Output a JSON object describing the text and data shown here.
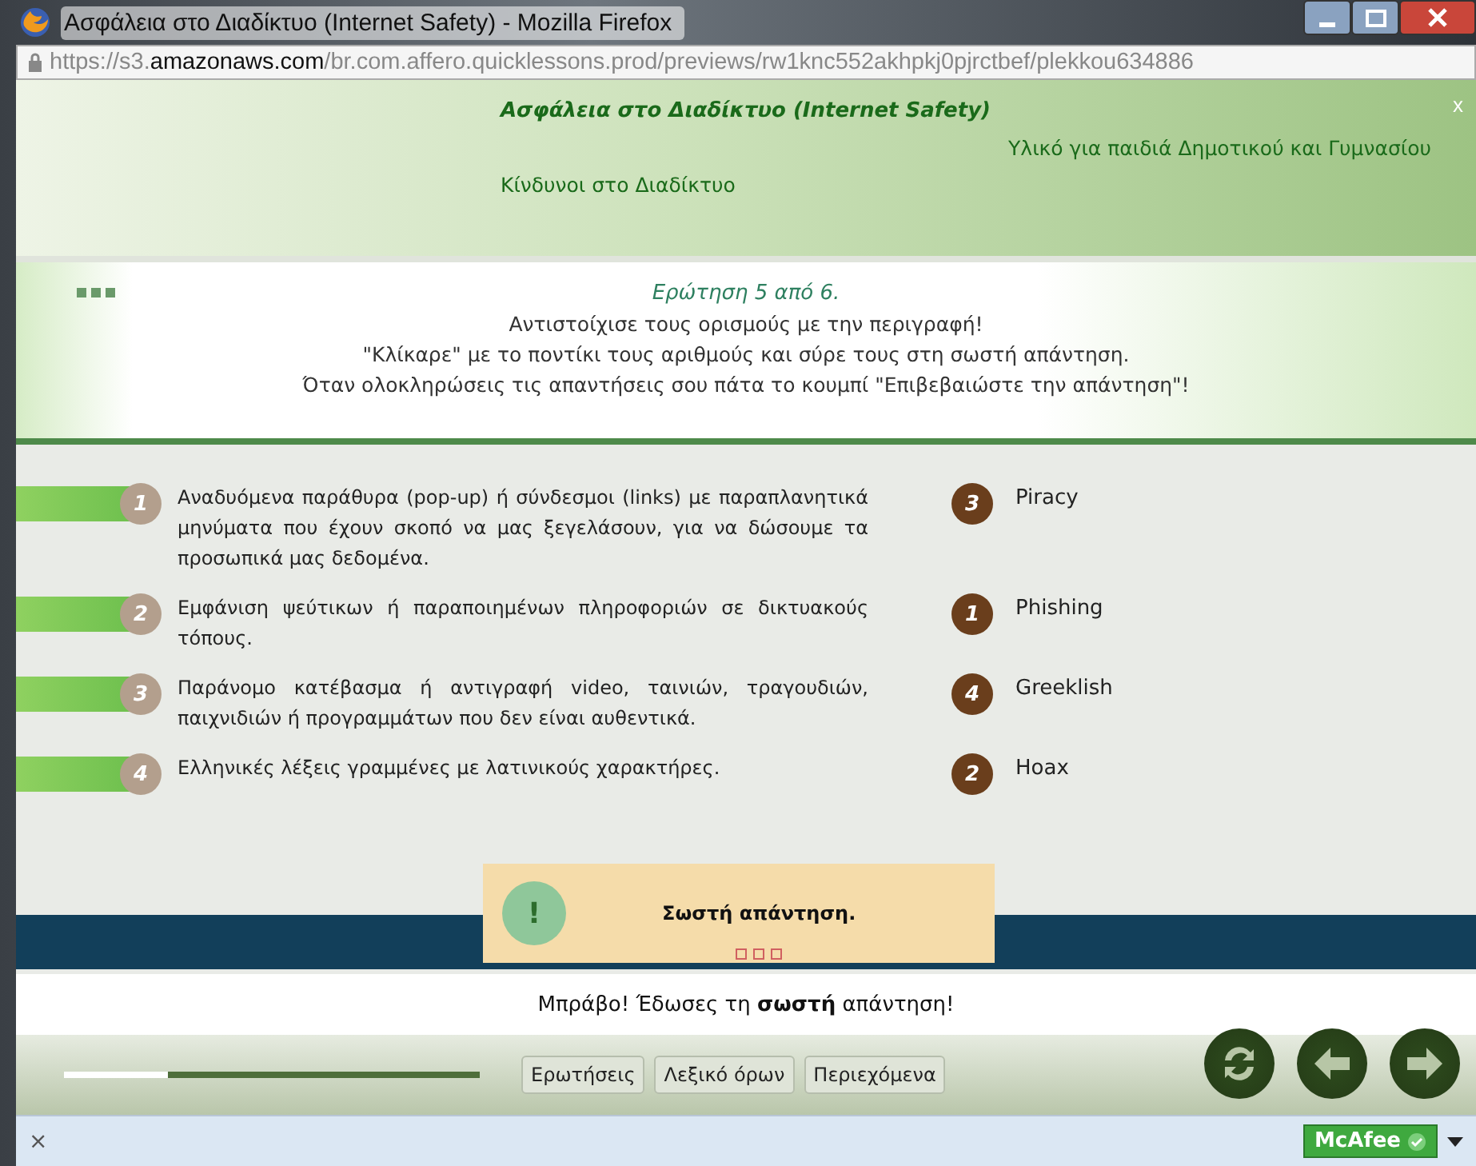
{
  "window": {
    "title": "Ασφάλεια στο Διαδίκτυο (Internet Safety) - Mozilla Firefox"
  },
  "address_bar": {
    "scheme": "https://s3.",
    "domain": "amazonaws.com",
    "path": "/br.com.affero.quicklessons.prod/previews/rw1knc552akhpkj0pjrctbef/plekkou634886"
  },
  "header": {
    "title": "Ασφάλεια στο Διαδίκτυο (Internet Safety)",
    "subtitle": "Υλικό για παιδιά Δημοτικού και Γυμνασίου",
    "section": "Κίνδυνοι στο Διαδίκτυο",
    "close": "x"
  },
  "question": {
    "counter": "Ερώτηση 5 από 6.",
    "instructions": [
      "Αντιστοίχισε τους ορισμούς με την περιγραφή!",
      "\"Κλίκαρε\" με το ποντίκι τους αριθμούς και σύρε τους στη σωστή απάντηση.",
      "Όταν ολοκληρώσεις τις απαντήσεις σου πάτα το κουμπί \"Επιβεβαιώστε την απάντηση\"!"
    ]
  },
  "pairs": [
    {
      "number": "1",
      "description": "Αναδυόμενα παράθυρα (pop-up) ή σύνδεσμοι (links) με παραπλανητικά μηνύματα που έχουν σκοπό να μας ξεγελάσουν, για να δώσουμε τα προσωπικά μας δεδομένα.",
      "answer_number": "3",
      "term": "Piracy"
    },
    {
      "number": "2",
      "description": "Εμφάνιση ψεύτικων ή παραποιημένων πληροφοριών σε δικτυακούς τόπους.",
      "answer_number": "1",
      "term": "Phishing"
    },
    {
      "number": "3",
      "description": "Παράνομο κατέβασμα ή αντιγραφή video, ταινιών, τραγουδιών, παιχνιδιών ή προγραμμάτων που δεν είναι αυθεντικά.",
      "answer_number": "4",
      "term": "Greeklish"
    },
    {
      "number": "4",
      "description": "Ελληνικές λέξεις γραμμένες με λατινικούς χαρακτήρες.",
      "answer_number": "2",
      "term": "Hoax"
    }
  ],
  "feedback": {
    "icon": "!",
    "title": "Σωστή απάντηση.",
    "message": "Μπράβο! Έδωσες τη **σωστή** απάντηση!"
  },
  "footer": {
    "progress": {
      "level": 0.25
    },
    "buttons": [
      "Ερωτήσεις",
      "Λεξικό όρων",
      "Περιεχόμενα"
    ]
  },
  "status_bar": {
    "close": "×",
    "addon": "McAfee"
  }
}
